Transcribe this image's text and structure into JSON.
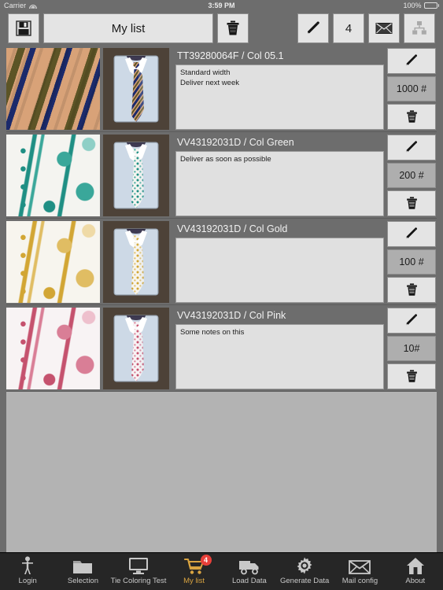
{
  "statusbar": {
    "carrier": "Carrier",
    "wifi_icon": "wifi-icon",
    "time": "3:59 PM",
    "battery_percent": "100%",
    "battery_icon": "battery-full-icon"
  },
  "toolbar": {
    "save_icon": "floppy-disk-save-icon",
    "title": "My list",
    "trash_icon": "trash-can-icon",
    "edit_icon": "pencil-edit-icon",
    "quantity_label": "4",
    "mail_icon": "envelope-mail-icon",
    "share_icon": "share-network-icon"
  },
  "list": {
    "rows": [
      {
        "title": "TT39280064F / Col 05.1",
        "notes": "Standard width\nDeliver next week",
        "quantity": "1000 #",
        "edit_icon": "pencil-edit-icon",
        "delete_icon": "trash-can-icon",
        "fabric_swatch": "striped-tan-navy-fabric",
        "tie_photo": "shirt-with-striped-tie",
        "colors": {
          "a": "#c89268",
          "b": "#1b2a6b",
          "c": "#5c5426",
          "base": "#d8a278"
        }
      },
      {
        "title": "VV43192031D / Col Green",
        "notes": "Deliver as soon as possible",
        "quantity": "200 #",
        "edit_icon": "pencil-edit-icon",
        "delete_icon": "trash-can-icon",
        "fabric_swatch": "paisley-green-fabric",
        "tie_photo": "shirt-with-green-paisley-tie",
        "colors": {
          "a": "#1f8f84",
          "b": "#3aa79a",
          "c": "#8fcfc6",
          "base": "#f4f4f0"
        }
      },
      {
        "title": "VV43192031D / Col Gold",
        "notes": "",
        "quantity": "100 #",
        "edit_icon": "pencil-edit-icon",
        "delete_icon": "trash-can-icon",
        "fabric_swatch": "paisley-gold-fabric",
        "tie_photo": "shirt-with-gold-paisley-tie",
        "colors": {
          "a": "#d2a634",
          "b": "#e0bd63",
          "c": "#efdaa6",
          "base": "#f7f5ee"
        }
      },
      {
        "title": "VV43192031D / Col Pink",
        "notes": "Some notes on this",
        "quantity": "10#",
        "edit_icon": "pencil-edit-icon",
        "delete_icon": "trash-can-icon",
        "fabric_swatch": "paisley-pink-fabric",
        "tie_photo": "shirt-with-pink-paisley-tie",
        "colors": {
          "a": "#c5526e",
          "b": "#d97e96",
          "c": "#eec0cd",
          "base": "#f8f3f4"
        }
      }
    ]
  },
  "tabbar": {
    "tabs": [
      {
        "label": "Login",
        "icon": "person-icon",
        "active": false
      },
      {
        "label": "Selection",
        "icon": "folder-icon",
        "active": false
      },
      {
        "label": "Tie Coloring Test",
        "icon": "monitor-icon",
        "active": false
      },
      {
        "label": "My list",
        "icon": "shopping-cart-icon",
        "active": true,
        "badge": "4"
      },
      {
        "label": "Load Data",
        "icon": "truck-icon",
        "active": false
      },
      {
        "label": "Generate Data",
        "icon": "gear-icon",
        "active": false
      },
      {
        "label": "Mail config",
        "icon": "envelope-icon",
        "active": false
      },
      {
        "label": "About",
        "icon": "home-icon",
        "active": false
      }
    ]
  },
  "theme": {
    "accent": "#d9a441",
    "badge": "#e8403a",
    "toolbar_bg": "#6d6d6d",
    "tabbar_bg": "#262626",
    "empty_list_bg": "#b3b3b3"
  }
}
